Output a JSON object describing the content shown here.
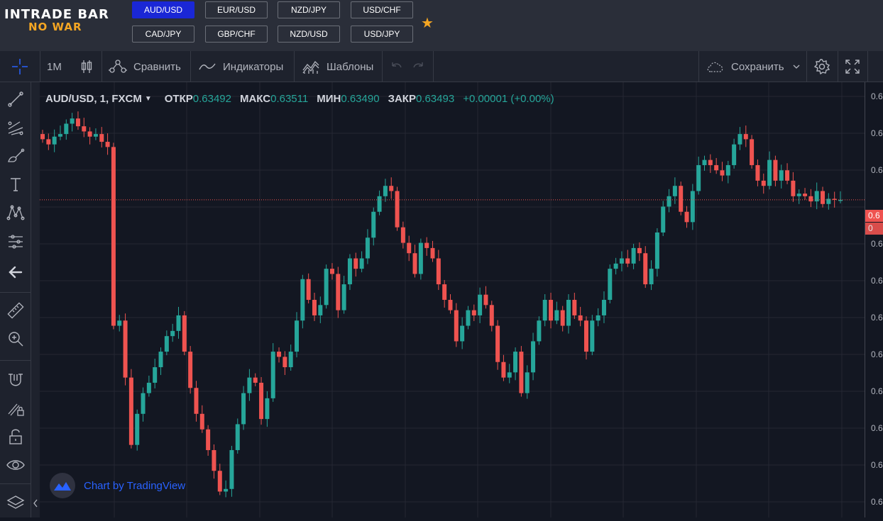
{
  "logo": {
    "main": "INTRADE BAR",
    "sub": "NO WAR"
  },
  "pairs": [
    {
      "label": "AUD/USD",
      "active": true
    },
    {
      "label": "EUR/USD",
      "active": false
    },
    {
      "label": "NZD/JPY",
      "active": false
    },
    {
      "label": "USD/CHF",
      "active": false
    },
    {
      "label": "CAD/JPY",
      "active": false
    },
    {
      "label": "GBP/CHF",
      "active": false
    },
    {
      "label": "NZD/USD",
      "active": false
    },
    {
      "label": "USD/JPY",
      "active": false
    }
  ],
  "favorite_icon": "star-icon",
  "toolbar": {
    "interval": "1M",
    "compare": "Сравнить",
    "indicators": "Индикаторы",
    "templates": "Шаблоны",
    "save": "Сохранить"
  },
  "legend": {
    "symbol": "AUD/USD, 1, FXCM",
    "open_label": "ОТКР",
    "open": "0.63492",
    "high_label": "МАКС",
    "high": "0.63511",
    "low_label": "МИН",
    "low": "0.63490",
    "close_label": "ЗАКР",
    "close": "0.63493",
    "change": "+0.00001 (+0.00%)"
  },
  "price_axis": {
    "tick_label": "0.6",
    "current_label": "0.6",
    "current_label2": "0"
  },
  "watermark": "Chart by TradingView",
  "colors": {
    "up": "#26a69a",
    "down": "#ef5350",
    "background": "#131722",
    "active_pair": "#1a27d6",
    "accent_star": "#f5a623"
  },
  "chart_data": {
    "type": "candlestick",
    "candles": [
      {
        "o": 0.6362,
        "c": 0.6361
      },
      {
        "o": 0.6361,
        "c": 0.636
      },
      {
        "o": 0.636,
        "c": 0.63615
      },
      {
        "o": 0.63615,
        "c": 0.6362
      },
      {
        "o": 0.6362,
        "c": 0.6364
      },
      {
        "o": 0.6364,
        "c": 0.6365
      },
      {
        "o": 0.6365,
        "c": 0.63635
      },
      {
        "o": 0.63635,
        "c": 0.63625
      },
      {
        "o": 0.63625,
        "c": 0.63615
      },
      {
        "o": 0.63615,
        "c": 0.6362
      },
      {
        "o": 0.6362,
        "c": 0.63605
      },
      {
        "o": 0.63605,
        "c": 0.63595
      },
      {
        "o": 0.63595,
        "c": 0.6325
      },
      {
        "o": 0.6325,
        "c": 0.6326
      },
      {
        "o": 0.6326,
        "c": 0.6315
      },
      {
        "o": 0.6315,
        "c": 0.6302
      },
      {
        "o": 0.6302,
        "c": 0.6308
      },
      {
        "o": 0.6308,
        "c": 0.6312
      },
      {
        "o": 0.6312,
        "c": 0.6314
      },
      {
        "o": 0.6314,
        "c": 0.6317
      },
      {
        "o": 0.6317,
        "c": 0.632
      },
      {
        "o": 0.632,
        "c": 0.6323
      },
      {
        "o": 0.6323,
        "c": 0.6324
      },
      {
        "o": 0.6324,
        "c": 0.6327
      },
      {
        "o": 0.6327,
        "c": 0.632
      },
      {
        "o": 0.632,
        "c": 0.6313
      },
      {
        "o": 0.6313,
        "c": 0.6308
      },
      {
        "o": 0.6308,
        "c": 0.6305
      },
      {
        "o": 0.6305,
        "c": 0.6301
      },
      {
        "o": 0.6301,
        "c": 0.6297
      },
      {
        "o": 0.6297,
        "c": 0.6293
      },
      {
        "o": 0.6293,
        "c": 0.62935
      },
      {
        "o": 0.62935,
        "c": 0.6301
      },
      {
        "o": 0.6301,
        "c": 0.6306
      },
      {
        "o": 0.6306,
        "c": 0.6312
      },
      {
        "o": 0.6312,
        "c": 0.6315
      },
      {
        "o": 0.6315,
        "c": 0.6314
      },
      {
        "o": 0.6314,
        "c": 0.6307
      },
      {
        "o": 0.6307,
        "c": 0.6311
      },
      {
        "o": 0.6311,
        "c": 0.632
      },
      {
        "o": 0.632,
        "c": 0.6319
      },
      {
        "o": 0.6319,
        "c": 0.6317
      },
      {
        "o": 0.6317,
        "c": 0.632
      },
      {
        "o": 0.632,
        "c": 0.6326
      },
      {
        "o": 0.6326,
        "c": 0.6334
      },
      {
        "o": 0.6334,
        "c": 0.633
      },
      {
        "o": 0.633,
        "c": 0.6327
      },
      {
        "o": 0.6327,
        "c": 0.6329
      },
      {
        "o": 0.6329,
        "c": 0.6336
      },
      {
        "o": 0.6336,
        "c": 0.6335
      },
      {
        "o": 0.6335,
        "c": 0.6328
      },
      {
        "o": 0.6328,
        "c": 0.6333
      },
      {
        "o": 0.6333,
        "c": 0.6338
      },
      {
        "o": 0.6338,
        "c": 0.6336
      },
      {
        "o": 0.6336,
        "c": 0.6338
      },
      {
        "o": 0.6338,
        "c": 0.6342
      },
      {
        "o": 0.6342,
        "c": 0.6347
      },
      {
        "o": 0.6347,
        "c": 0.635
      },
      {
        "o": 0.635,
        "c": 0.6352
      },
      {
        "o": 0.6352,
        "c": 0.6351
      },
      {
        "o": 0.6351,
        "c": 0.6344
      },
      {
        "o": 0.6344,
        "c": 0.6341
      },
      {
        "o": 0.6341,
        "c": 0.6339
      },
      {
        "o": 0.6339,
        "c": 0.6335
      },
      {
        "o": 0.6335,
        "c": 0.6341
      },
      {
        "o": 0.6341,
        "c": 0.634
      },
      {
        "o": 0.634,
        "c": 0.6338
      },
      {
        "o": 0.6338,
        "c": 0.6333
      },
      {
        "o": 0.6333,
        "c": 0.633
      },
      {
        "o": 0.633,
        "c": 0.6328
      },
      {
        "o": 0.6328,
        "c": 0.6322
      },
      {
        "o": 0.6322,
        "c": 0.6325
      },
      {
        "o": 0.6325,
        "c": 0.6328
      },
      {
        "o": 0.6328,
        "c": 0.6327
      },
      {
        "o": 0.6327,
        "c": 0.6331
      },
      {
        "o": 0.6331,
        "c": 0.6329
      },
      {
        "o": 0.6329,
        "c": 0.6325
      },
      {
        "o": 0.6325,
        "c": 0.6318
      },
      {
        "o": 0.6318,
        "c": 0.6315
      },
      {
        "o": 0.6315,
        "c": 0.6316
      },
      {
        "o": 0.6316,
        "c": 0.632
      },
      {
        "o": 0.632,
        "c": 0.6312
      },
      {
        "o": 0.6312,
        "c": 0.6316
      },
      {
        "o": 0.6316,
        "c": 0.6322
      },
      {
        "o": 0.6322,
        "c": 0.6326
      },
      {
        "o": 0.6326,
        "c": 0.633
      },
      {
        "o": 0.633,
        "c": 0.6326
      },
      {
        "o": 0.6326,
        "c": 0.6328
      },
      {
        "o": 0.6328,
        "c": 0.6325
      },
      {
        "o": 0.6325,
        "c": 0.633
      },
      {
        "o": 0.633,
        "c": 0.6327
      },
      {
        "o": 0.6327,
        "c": 0.6326
      },
      {
        "o": 0.6326,
        "c": 0.632
      },
      {
        "o": 0.632,
        "c": 0.6326
      },
      {
        "o": 0.6326,
        "c": 0.6327
      },
      {
        "o": 0.6327,
        "c": 0.633
      },
      {
        "o": 0.633,
        "c": 0.6336
      },
      {
        "o": 0.6336,
        "c": 0.6337
      },
      {
        "o": 0.6337,
        "c": 0.6338
      },
      {
        "o": 0.6338,
        "c": 0.6337
      },
      {
        "o": 0.6337,
        "c": 0.634
      },
      {
        "o": 0.634,
        "c": 0.6339
      },
      {
        "o": 0.6339,
        "c": 0.6333
      },
      {
        "o": 0.6333,
        "c": 0.6336
      },
      {
        "o": 0.6336,
        "c": 0.6343
      },
      {
        "o": 0.6343,
        "c": 0.6348
      },
      {
        "o": 0.6348,
        "c": 0.635
      },
      {
        "o": 0.635,
        "c": 0.6352
      },
      {
        "o": 0.6352,
        "c": 0.6347
      },
      {
        "o": 0.6347,
        "c": 0.6345
      },
      {
        "o": 0.6345,
        "c": 0.6351
      },
      {
        "o": 0.6351,
        "c": 0.6356
      },
      {
        "o": 0.6356,
        "c": 0.6357
      },
      {
        "o": 0.6357,
        "c": 0.6356
      },
      {
        "o": 0.6356,
        "c": 0.6355
      },
      {
        "o": 0.6355,
        "c": 0.6354
      },
      {
        "o": 0.6354,
        "c": 0.6356
      },
      {
        "o": 0.6356,
        "c": 0.636
      },
      {
        "o": 0.636,
        "c": 0.6362
      },
      {
        "o": 0.6362,
        "c": 0.6361
      },
      {
        "o": 0.6361,
        "c": 0.6356
      },
      {
        "o": 0.6356,
        "c": 0.6353
      },
      {
        "o": 0.6353,
        "c": 0.6352
      },
      {
        "o": 0.6352,
        "c": 0.6357
      },
      {
        "o": 0.6357,
        "c": 0.6353
      },
      {
        "o": 0.6353,
        "c": 0.6355
      },
      {
        "o": 0.6355,
        "c": 0.6353
      },
      {
        "o": 0.6353,
        "c": 0.635
      },
      {
        "o": 0.635,
        "c": 0.63505
      },
      {
        "o": 0.63505,
        "c": 0.635
      },
      {
        "o": 0.635,
        "c": 0.6349
      },
      {
        "o": 0.6349,
        "c": 0.6351
      },
      {
        "o": 0.6351,
        "c": 0.63485
      },
      {
        "o": 0.63485,
        "c": 0.63495
      },
      {
        "o": 0.63495,
        "c": 0.63493
      },
      {
        "o": 0.63493,
        "c": 0.63493
      }
    ],
    "current_price": 0.63493,
    "ylim": [
      0.6288,
      0.6372
    ]
  }
}
